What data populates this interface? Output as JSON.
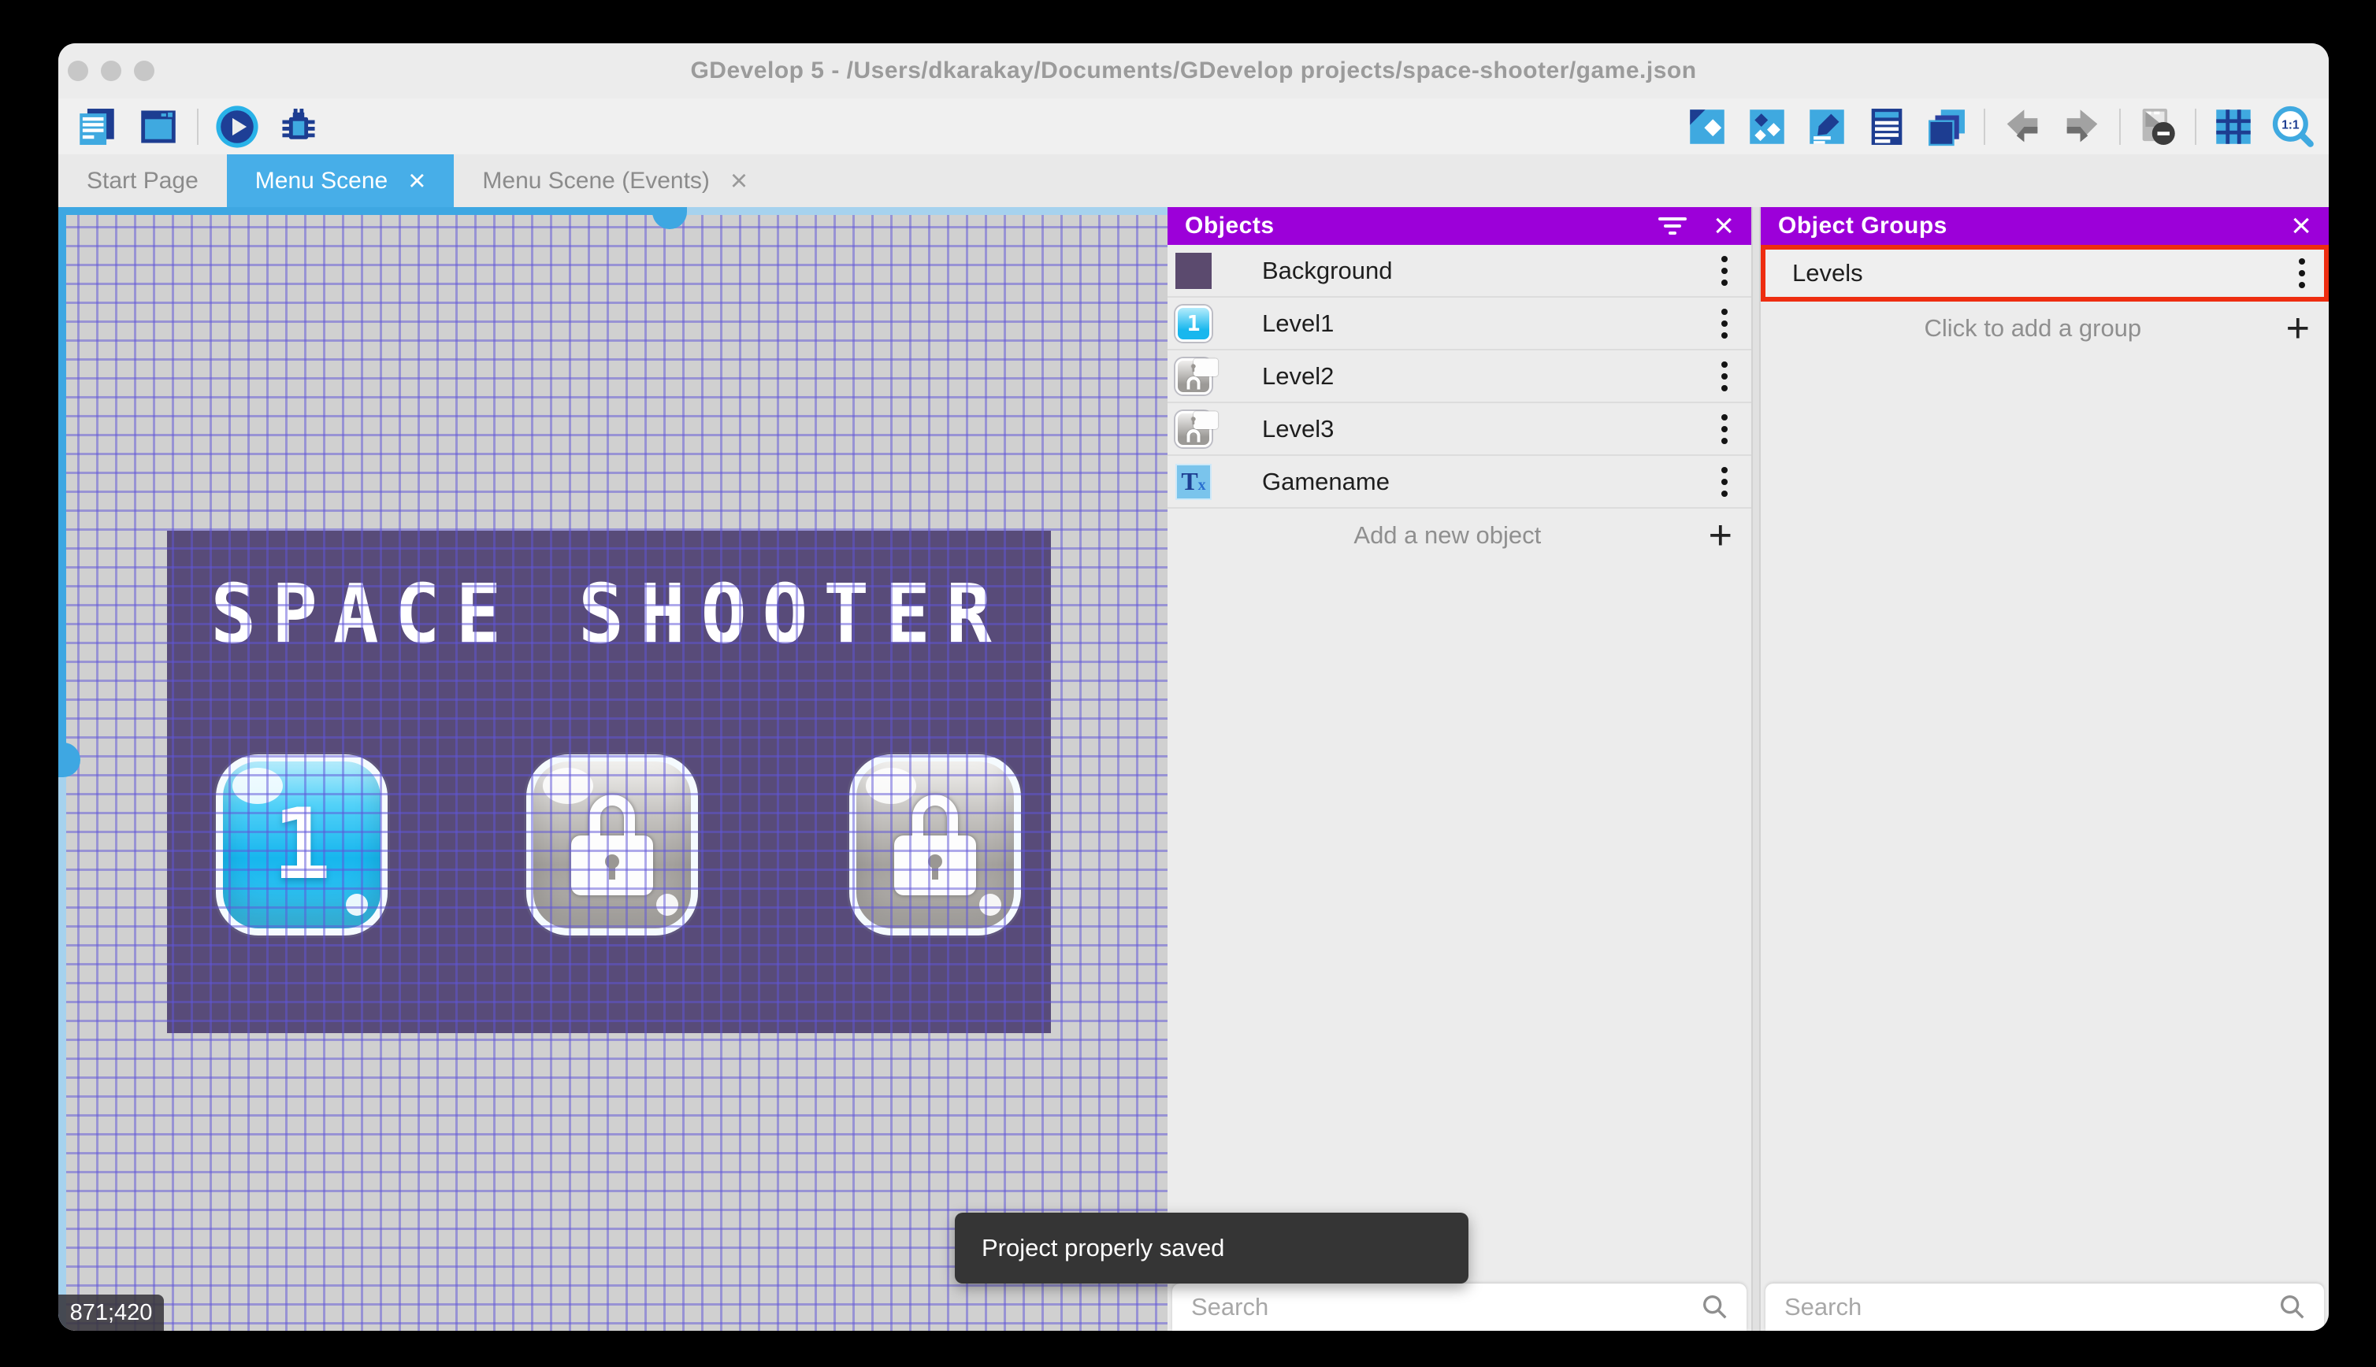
{
  "window": {
    "title": "GDevelop 5 - /Users/dkarakay/Documents/GDevelop projects/space-shooter/game.json"
  },
  "toolbar": {
    "left_icons": [
      "project-manager",
      "preview-window",
      "play",
      "debug"
    ],
    "right_icons": [
      "objects-editor",
      "object-groups-editor",
      "properties",
      "instances-list",
      "layers-editor",
      "undo",
      "redo",
      "instances-mask",
      "grid",
      "zoom-1-1"
    ]
  },
  "tabs": [
    {
      "label": "Start Page",
      "active": false,
      "closable": false
    },
    {
      "label": "Menu Scene",
      "active": true,
      "closable": true
    },
    {
      "label": "Menu Scene (Events)",
      "active": false,
      "closable": true
    }
  ],
  "canvas": {
    "coordinates": "871;420",
    "game": {
      "title": "SPACE SHOOTER",
      "buttons": [
        {
          "label": "1",
          "state": "unlocked"
        },
        {
          "label": "",
          "state": "locked"
        },
        {
          "label": "",
          "state": "locked"
        }
      ]
    }
  },
  "toast": {
    "message": "Project properly saved"
  },
  "objects_panel": {
    "title": "Objects",
    "items": [
      {
        "name": "Background",
        "thumb": "background-sprite"
      },
      {
        "name": "Level1",
        "thumb": "blue-level-button"
      },
      {
        "name": "Level2",
        "thumb": "locked-level-button"
      },
      {
        "name": "Level3",
        "thumb": "locked-level-button"
      },
      {
        "name": "Gamename",
        "thumb": "text-object"
      }
    ],
    "add_label": "Add a new object",
    "search_placeholder": "Search"
  },
  "groups_panel": {
    "title": "Object Groups",
    "items": [
      {
        "name": "Levels",
        "highlighted": true
      }
    ],
    "add_label": "Click to add a group",
    "search_placeholder": "Search"
  },
  "colors": {
    "panel_header": "#9c00d9",
    "active_tab": "#47aee8",
    "highlight_red": "#ee2d10",
    "toast_bg": "#353535",
    "scrollbar_blue": "#3ea7e2",
    "canvas_bg": "#d0d0d0",
    "game_bg": "#584b79"
  }
}
